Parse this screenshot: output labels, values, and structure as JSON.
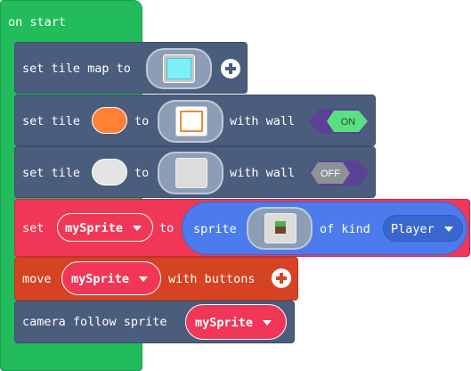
{
  "blocks": {
    "on_start": {
      "label": "on start"
    },
    "set_tile_map": {
      "label": "set tile map to"
    },
    "set_tile_1": {
      "label_set": "set tile",
      "label_to": "to",
      "label_wall": "with wall",
      "wall_toggle": "ON",
      "swatch_color": "#ff8135"
    },
    "set_tile_2": {
      "label_set": "set tile",
      "label_to": "to",
      "label_wall": "with wall",
      "wall_toggle": "OFF",
      "swatch_color": "#e4e4e4"
    },
    "set_sprite": {
      "label_set": "set",
      "variable": "mySprite",
      "label_to": "to",
      "label_sprite": "sprite",
      "label_kind": "of kind",
      "kind": "Player"
    },
    "move_sprite": {
      "label_move": "move",
      "variable": "mySprite",
      "label_buttons": "with buttons"
    },
    "camera_follow": {
      "label": "camera follow sprite",
      "variable": "mySprite"
    }
  },
  "colors": {
    "loops_green": "#22bc5c",
    "scene_slate": "#4b5d7c",
    "sprites_blue": "#4b7bec",
    "variables_red": "#f03757",
    "controller_orange": "#d54322",
    "toggle_on": "#59e181",
    "toggle_off": "#8c9296",
    "toggle_track": "#5b4296"
  },
  "icons": [
    "plus-icon",
    "tilemap-thumbnail",
    "tile-thumbnail",
    "sprite-thumbnail",
    "caret-down-icon"
  ]
}
